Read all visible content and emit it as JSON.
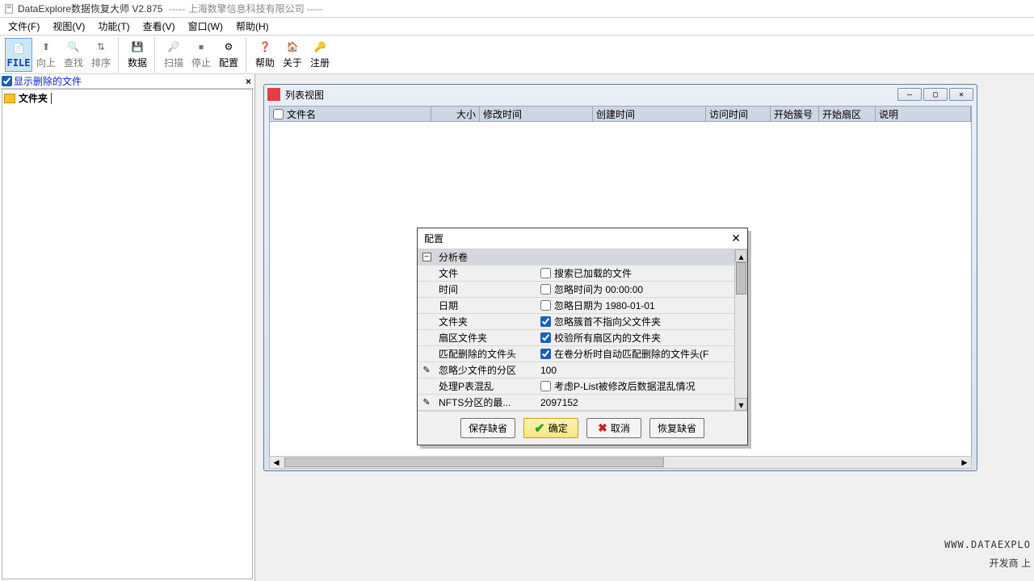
{
  "title": {
    "app": "DataExplore数据恢复大师 V2.875",
    "secondary": "-----  上海数擎信息科技有限公司 -----"
  },
  "menus": [
    "文件(F)",
    "视图(V)",
    "功能(T)",
    "查看(V)",
    "窗口(W)",
    "帮助(H)"
  ],
  "tools": [
    {
      "label": "FILE",
      "icon": "📄",
      "active": true
    },
    {
      "label": "向上",
      "icon": "⬆",
      "disabled": true
    },
    {
      "label": "查找",
      "icon": "🔍",
      "disabled": true
    },
    {
      "label": "排序",
      "icon": "⇅",
      "disabled": true
    },
    {
      "label": "数据",
      "icon": "💾"
    },
    {
      "label": "扫描",
      "icon": "🔎",
      "disabled": true
    },
    {
      "label": "停止",
      "icon": "⏹",
      "disabled": true
    },
    {
      "label": "配置",
      "icon": "⚙"
    },
    {
      "label": "帮助",
      "icon": "❓"
    },
    {
      "label": "关于",
      "icon": "🏠"
    },
    {
      "label": "注册",
      "icon": "🔑"
    }
  ],
  "sidebar": {
    "show_deleted": "显示删除的文件",
    "root": "文件夹"
  },
  "child": {
    "title": "列表视图",
    "cols": [
      "文件名",
      "大小",
      "修改时间",
      "创建时间",
      "访问时间",
      "开始簇号",
      "开始扇区",
      "说明"
    ]
  },
  "dialog": {
    "title": "配置",
    "group": "分析卷",
    "rows": [
      {
        "k": "文件",
        "cb": false,
        "v": "搜索已加载的文件"
      },
      {
        "k": "时间",
        "cb": false,
        "v": "忽略时间为 00:00:00"
      },
      {
        "k": "日期",
        "cb": false,
        "v": "忽略日期为 1980-01-01"
      },
      {
        "k": "文件夹",
        "cb": true,
        "v": "忽略簇首不指向父文件夹"
      },
      {
        "k": "扇区文件夹",
        "cb": true,
        "v": "校验所有扇区内的文件夹"
      },
      {
        "k": "匹配删除的文件头",
        "cb": true,
        "v": "在卷分析时自动匹配删除的文件头(F"
      },
      {
        "k": "忽略少文件的分区",
        "pencil": true,
        "text": "100"
      },
      {
        "k": "处理P表混乱",
        "cb": false,
        "v": "考虑P-List被修改后数据混乱情况"
      },
      {
        "k": "NFTS分区的最...",
        "pencil": true,
        "text": "2097152"
      }
    ],
    "btns": {
      "save": "保存缺省",
      "ok": "确定",
      "cancel": "取消",
      "restore": "恢复缺省"
    }
  },
  "footer": {
    "url": "WWW.DATAEXPLO",
    "dev": "开发商   上"
  }
}
